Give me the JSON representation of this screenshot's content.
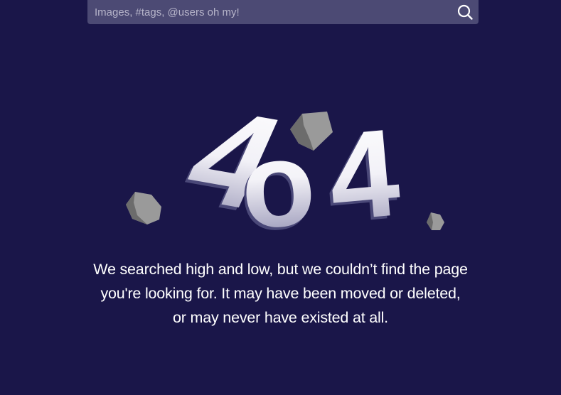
{
  "search": {
    "placeholder": "Images, #tags, @users oh my!",
    "value": "",
    "icon": "search-icon"
  },
  "error": {
    "code_characters": [
      "4",
      "o",
      "4"
    ],
    "message_lines": [
      "We searched high and low, but we couldn’t find the page",
      "you're looking for. It may have been moved or deleted,",
      "or may never have existed at all."
    ]
  },
  "colors": {
    "background": "#1a1649",
    "search_bar": "#4c4a74",
    "text": "#ffffff",
    "rock_light": "#9a9a9a",
    "rock_dark": "#6c6c6c"
  }
}
